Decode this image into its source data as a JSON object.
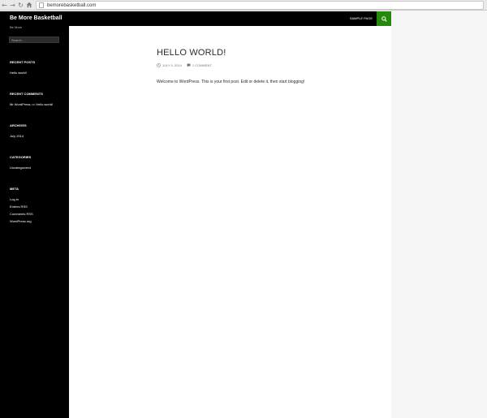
{
  "browser": {
    "url": "bemorebasketball.com"
  },
  "site": {
    "title": "Be More Basketball",
    "description": "Be More"
  },
  "search": {
    "placeholder": "Search …"
  },
  "nav": {
    "sample_page": "SAMPLE PAGE"
  },
  "widgets": {
    "recent_posts": {
      "title": "RECENT POSTS",
      "items": [
        "Hello world!"
      ]
    },
    "recent_comments": {
      "title": "RECENT COMMENTS",
      "author": "Mr WordPress",
      "connector": "on",
      "post": "Hello world!"
    },
    "archives": {
      "title": "ARCHIVES",
      "items": [
        "July 2014"
      ]
    },
    "categories": {
      "title": "CATEGORIES",
      "items": [
        "Uncategorized"
      ]
    },
    "meta": {
      "title": "META",
      "items": [
        "Log in",
        "Entries RSS",
        "Comments RSS",
        "WordPress.org"
      ]
    }
  },
  "post": {
    "title": "HELLO WORLD!",
    "date": "JULY 9, 2014",
    "comments": "1 COMMENT",
    "body": "Welcome to WordPress. This is your first post. Edit or delete it, then start blogging!"
  },
  "colors": {
    "accent": "#24890d",
    "sidebar_bg": "#000000",
    "content_bg": "#ffffff",
    "page_bg": "#f5f5f5"
  }
}
